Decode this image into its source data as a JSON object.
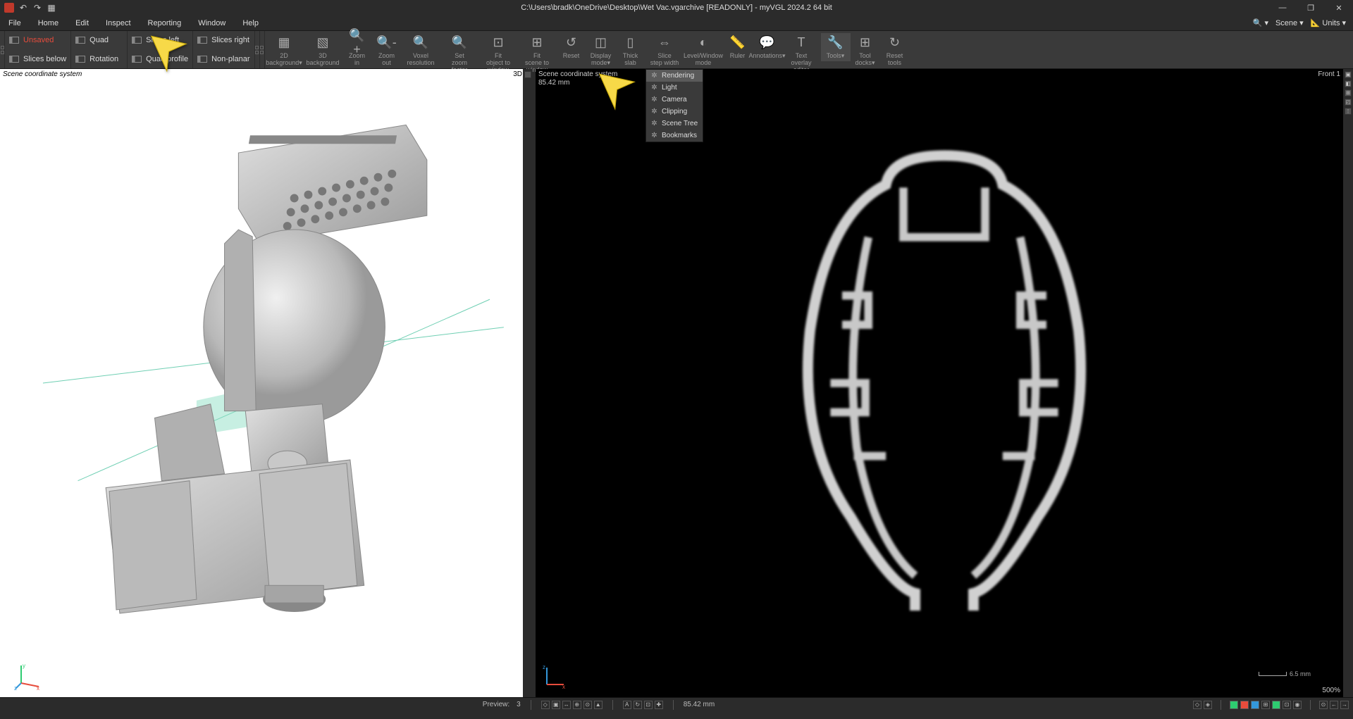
{
  "title": "C:\\Users\\bradk\\OneDrive\\Desktop\\Wet Vac.vgarchive [READONLY] - myVGL 2024.2 64 bit",
  "menu": [
    "File",
    "Home",
    "Edit",
    "Inspect",
    "Reporting",
    "Window",
    "Help"
  ],
  "topright": {
    "search": "",
    "scene": "Scene",
    "units": "Units"
  },
  "layouts": {
    "row1": [
      "Unsaved",
      "Quad",
      "Slices left",
      "Slices right"
    ],
    "row2": [
      "Slices below",
      "Rotation",
      "Quad profile",
      "Non-planar"
    ]
  },
  "tools": [
    {
      "label": "2D background",
      "dropdown": true
    },
    {
      "label": "3D background"
    },
    {
      "label": "Zoom in"
    },
    {
      "label": "Zoom out"
    },
    {
      "label": "Voxel resolution"
    },
    {
      "label": "Set zoom factor"
    },
    {
      "label": "Fit object to window"
    },
    {
      "label": "Fit scene to window"
    },
    {
      "label": "Reset"
    },
    {
      "label": "Display mode",
      "dropdown": true
    },
    {
      "label": "Thick slab"
    },
    {
      "label": "Slice step width"
    },
    {
      "label": "Level/Window mode"
    },
    {
      "label": "Ruler"
    },
    {
      "label": "Annotations",
      "dropdown": true
    },
    {
      "label": "Text overlay editor"
    },
    {
      "label": "Tools",
      "dropdown": true,
      "active": true
    },
    {
      "label": "Tool docks",
      "dropdown": true
    },
    {
      "label": "Reset tools"
    }
  ],
  "dropdown": {
    "items": [
      "Rendering",
      "Light",
      "Camera",
      "Clipping",
      "Scene Tree",
      "Bookmarks"
    ],
    "selected": 0
  },
  "viewport3d": {
    "label_tl": "Scene coordinate system",
    "label_tr": "3D"
  },
  "viewport2d": {
    "label_tl": "Scene coordinate system",
    "sub": "85.42 mm",
    "label_tr": "Front 1",
    "scale": "6.5 mm",
    "zoom": "500%"
  },
  "status": {
    "preview": "Preview:",
    "preview_value": "3",
    "distance": "85.42 mm"
  }
}
